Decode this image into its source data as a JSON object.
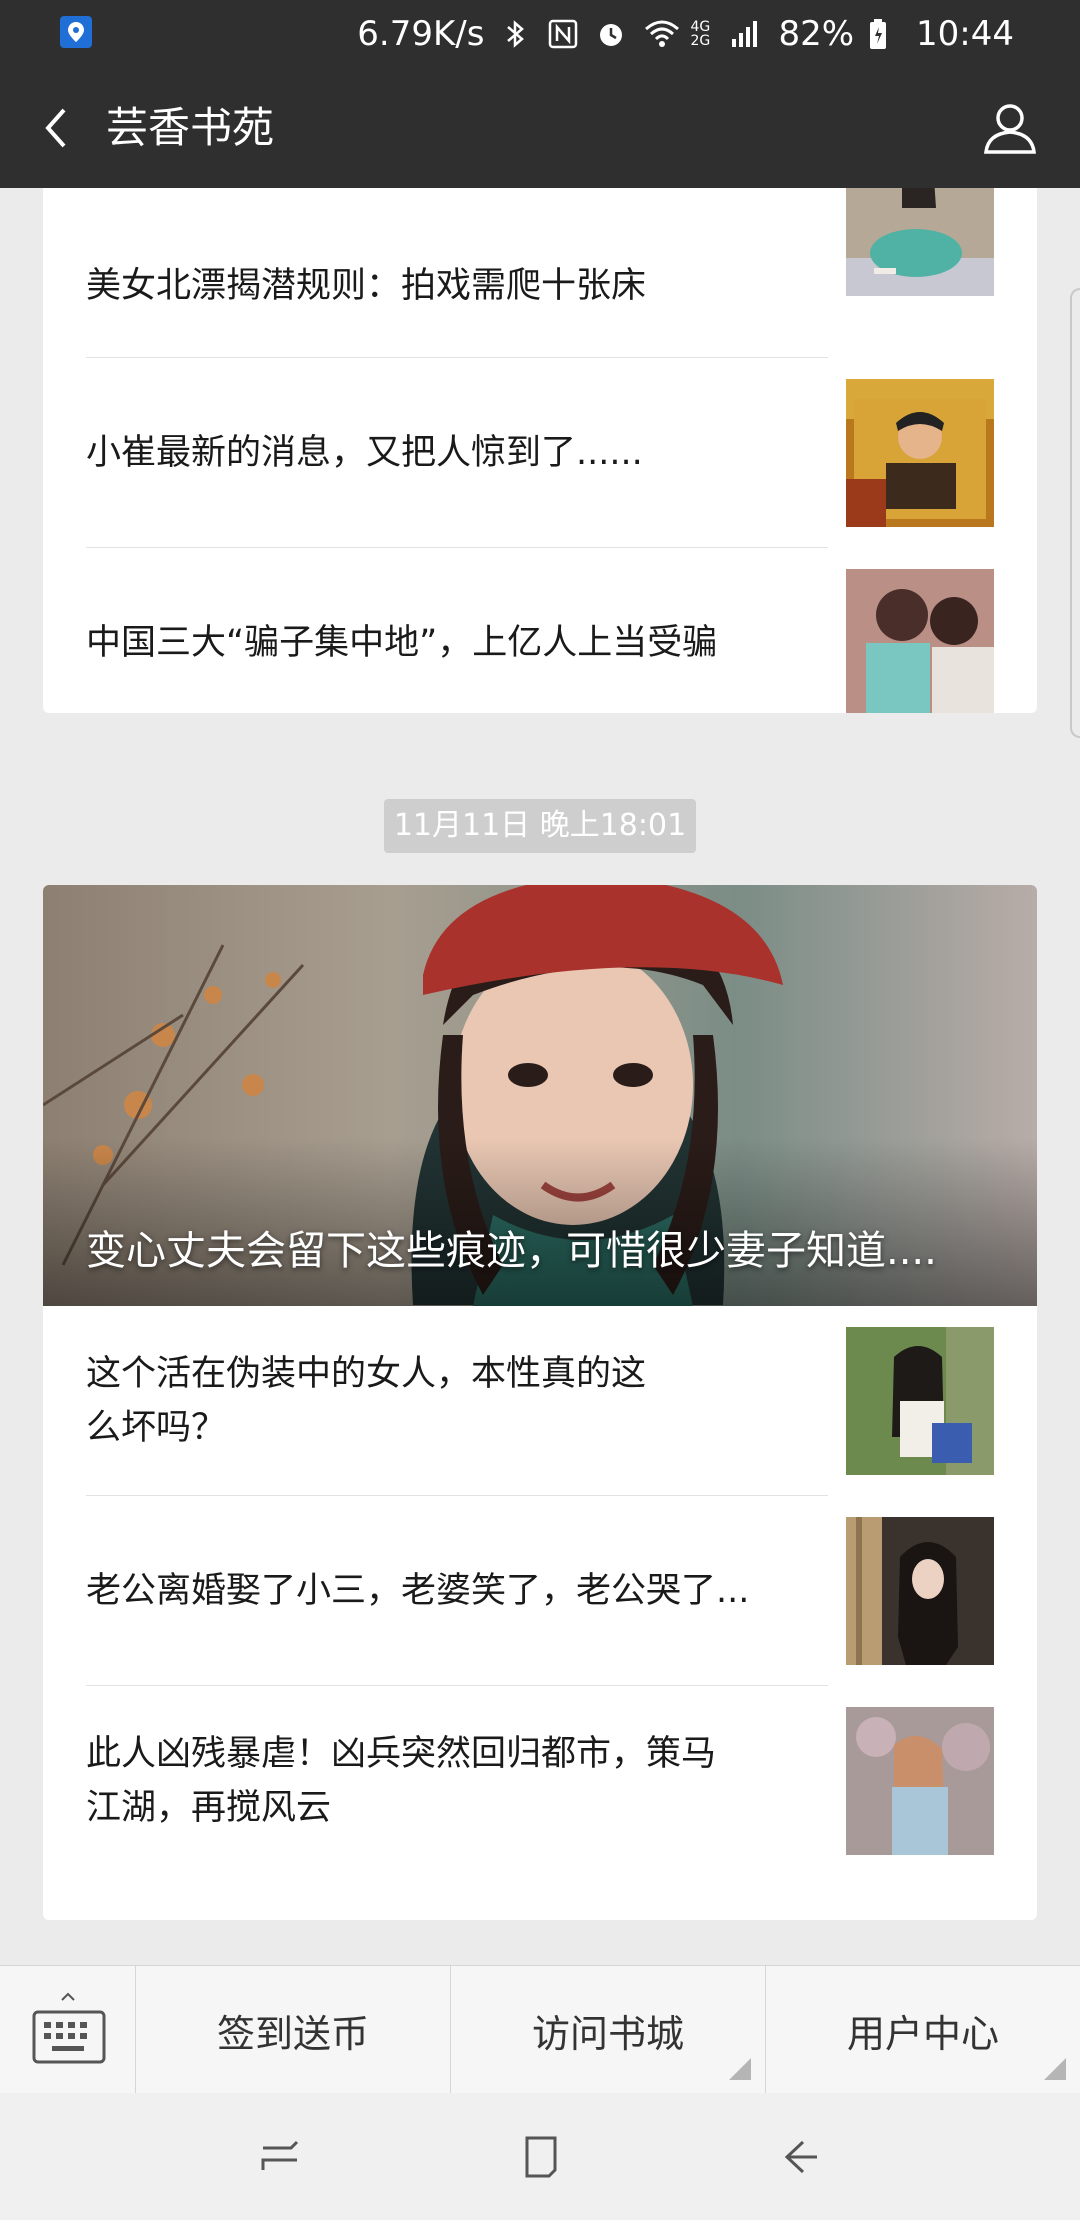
{
  "status_bar": {
    "speed": "6.79K/s",
    "network_label": "4G 2G",
    "battery": "82%",
    "time": "10:44"
  },
  "header": {
    "title": "芸香书苑"
  },
  "card1": {
    "rows": [
      {
        "title": "美女北漂揭潜规则：拍戏需爬十张床"
      },
      {
        "title": "小崔最新的消息，又把人惊到了......"
      },
      {
        "title": "中国三大“骗子集中地”，上亿人上当受骗"
      }
    ]
  },
  "timestamp": "11月11日 晚上18:01",
  "card2": {
    "hero_title": "变心丈夫会留下这些痕迹，可惜很少妻子知道....",
    "rows": [
      {
        "title": "这个活在伪装中的女人，本性真的这么坏吗？"
      },
      {
        "title": "老公离婚娶了小三，老婆笑了，老公哭了..."
      },
      {
        "title": "此人凶残暴虐！凶兵突然回归都市，策马江湖，再搅风云"
      }
    ]
  },
  "menu": {
    "item1": "签到送币",
    "item2": "访问书城",
    "item3": "用户中心"
  },
  "colors": {
    "header_bg": "#2f2f2f",
    "page_bg": "#ebebeb",
    "timestamp_bg": "#cecece"
  }
}
